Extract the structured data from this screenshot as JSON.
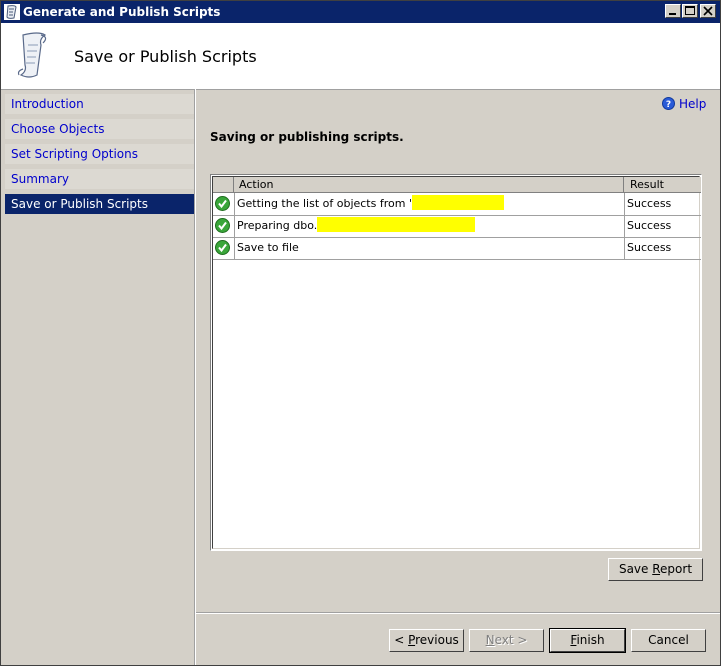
{
  "window": {
    "title": "Generate and Publish Scripts",
    "controls": [
      "minimize",
      "maximize",
      "close"
    ]
  },
  "header": {
    "title": "Save or Publish Scripts",
    "icon": "scroll-icon"
  },
  "sidebar": {
    "items": [
      {
        "label": "Introduction",
        "selected": false
      },
      {
        "label": "Choose Objects",
        "selected": false
      },
      {
        "label": "Set Scripting Options",
        "selected": false
      },
      {
        "label": "Summary",
        "selected": false
      },
      {
        "label": "Save or Publish Scripts",
        "selected": true
      }
    ]
  },
  "help": {
    "label": "Help",
    "icon": "help-icon"
  },
  "main": {
    "status_text": "Saving or publishing scripts.",
    "table": {
      "columns": [
        "",
        "Action",
        "Result"
      ],
      "rows": [
        {
          "icon": "success-check-icon",
          "action": "Getting the list of objects from '",
          "result": "Success"
        },
        {
          "icon": "success-check-icon",
          "action": "Preparing dbo.",
          "result": "Success"
        },
        {
          "icon": "success-check-icon",
          "action": "Save to file",
          "result": "Success"
        }
      ]
    },
    "save_report": {
      "pre": "Save ",
      "accel": "R",
      "post": "eport"
    }
  },
  "footer": {
    "previous": {
      "pre": "< ",
      "accel": "P",
      "post": "revious",
      "enabled": true
    },
    "next": {
      "pre": "",
      "accel": "N",
      "post": "ext >",
      "enabled": false
    },
    "finish": {
      "pre": "",
      "accel": "F",
      "post": "inish",
      "enabled": true
    },
    "cancel": {
      "label": "Cancel",
      "enabled": true
    }
  },
  "colors": {
    "title_bar": "#0a246a",
    "selected_item": "#0a246a",
    "link": "#0000cc",
    "success": "#2e9e2e",
    "redaction": "#ffff00"
  }
}
